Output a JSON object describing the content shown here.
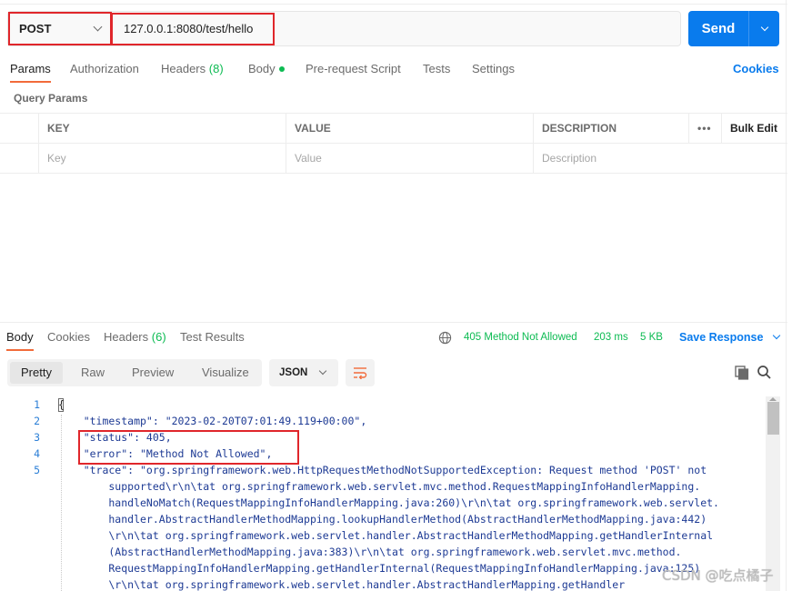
{
  "request": {
    "method": "POST",
    "url": "127.0.0.1:8080/test/hello",
    "send_label": "Send"
  },
  "request_tabs": [
    {
      "label": "Params"
    },
    {
      "label": "Authorization"
    },
    {
      "label": "Headers",
      "count": "(8)"
    },
    {
      "label": "Body"
    },
    {
      "label": "Pre-request Script"
    },
    {
      "label": "Tests"
    },
    {
      "label": "Settings"
    }
  ],
  "cookies_link": "Cookies",
  "query_params": {
    "title": "Query Params",
    "columns": [
      "KEY",
      "VALUE",
      "DESCRIPTION"
    ],
    "more": "•••",
    "bulk_edit": "Bulk Edit",
    "placeholders": {
      "key": "Key",
      "value": "Value",
      "description": "Description"
    }
  },
  "response_tabs": [
    {
      "label": "Body"
    },
    {
      "label": "Cookies"
    },
    {
      "label": "Headers",
      "count": "(6)"
    },
    {
      "label": "Test Results"
    }
  ],
  "response_meta": {
    "status": "405 Method Not Allowed",
    "time": "203 ms",
    "size": "5 KB",
    "save_label": "Save Response"
  },
  "view_modes": [
    "Pretty",
    "Raw",
    "Preview",
    "Visualize"
  ],
  "format": "JSON",
  "code_lines": [
    {
      "n": "1",
      "text": "{"
    },
    {
      "n": "2",
      "text": "    \"timestamp\": \"2023-02-20T07:01:49.119+00:00\","
    },
    {
      "n": "3",
      "text": "    \"status\": 405,"
    },
    {
      "n": "4",
      "text": "    \"error\": \"Method Not Allowed\","
    },
    {
      "n": "5",
      "text": "    \"trace\": \"org.springframework.web.HttpRequestMethodNotSupportedException: Request method 'POST' not"
    },
    {
      "n": "",
      "text": "        supported\\r\\n\\tat org.springframework.web.servlet.mvc.method.RequestMappingInfoHandlerMapping."
    },
    {
      "n": "",
      "text": "        handleNoMatch(RequestMappingInfoHandlerMapping.java:260)\\r\\n\\tat org.springframework.web.servlet."
    },
    {
      "n": "",
      "text": "        handler.AbstractHandlerMethodMapping.lookupHandlerMethod(AbstractHandlerMethodMapping.java:442)"
    },
    {
      "n": "",
      "text": "        \\r\\n\\tat org.springframework.web.servlet.handler.AbstractHandlerMethodMapping.getHandlerInternal"
    },
    {
      "n": "",
      "text": "        (AbstractHandlerMethodMapping.java:383)\\r\\n\\tat org.springframework.web.servlet.mvc.method."
    },
    {
      "n": "",
      "text": "        RequestMappingInfoHandlerMapping.getHandlerInternal(RequestMappingInfoHandlerMapping.java:125)"
    },
    {
      "n": "",
      "text": "        \\r\\n\\tat org.springframework.web.servlet.handler.AbstractHandlerMapping.getHandler"
    }
  ],
  "watermark": "CSDN @吃点橘子",
  "colors": {
    "accent": "#097bed",
    "status_ok": "#0cbb52",
    "tab_underline": "#f26b3a",
    "highlight": "#e0262b"
  }
}
